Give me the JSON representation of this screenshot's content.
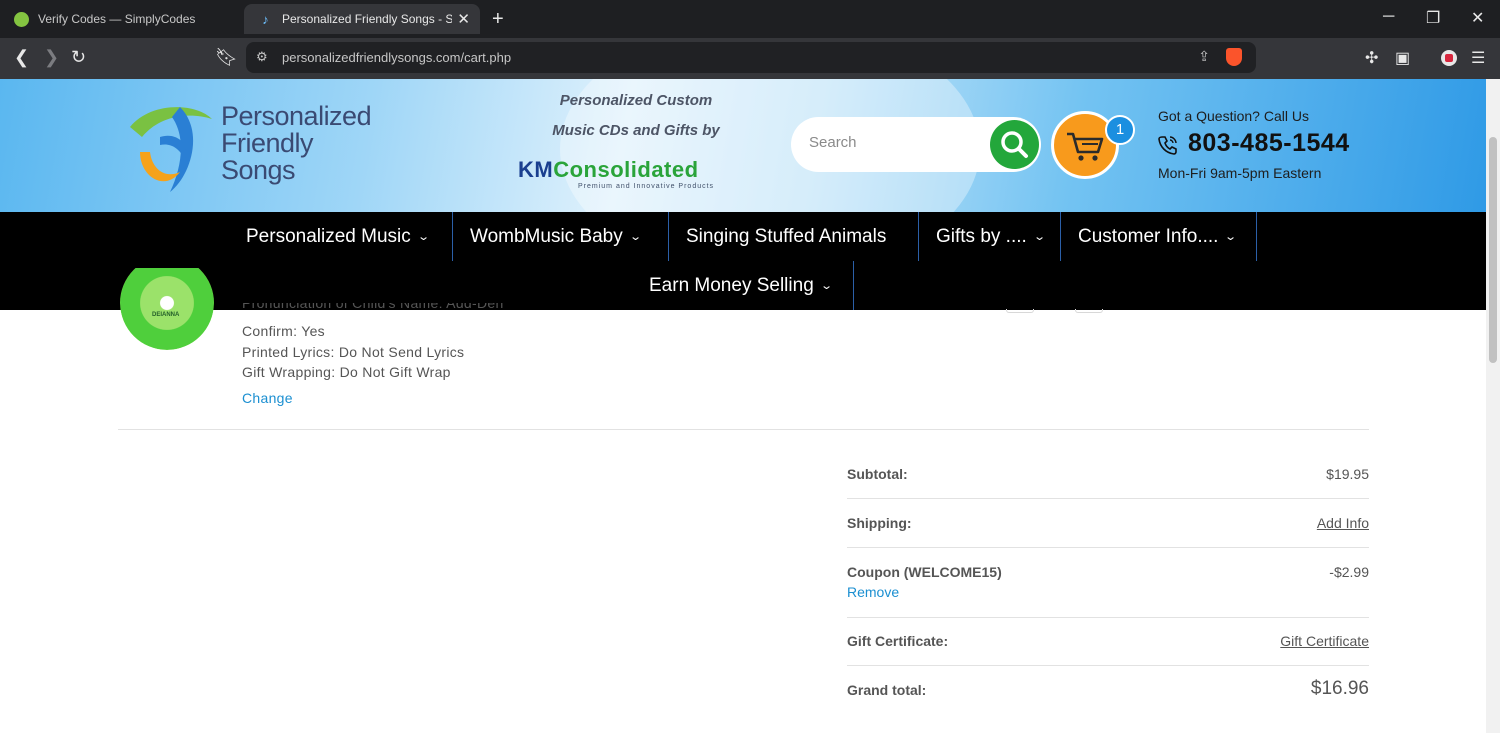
{
  "browser": {
    "tabs": [
      {
        "title": "Verify Codes — SimplyCodes",
        "active": false
      },
      {
        "title": "Personalized Friendly Songs - Sh",
        "active": true
      }
    ],
    "url": "personalizedfriendlysongs.com/cart.php"
  },
  "header": {
    "logo_line1": "Personalized",
    "logo_line2": "Friendly",
    "logo_line3": "Songs",
    "tagline_line1": "Personalized Custom",
    "tagline_line2": "Music CDs and Gifts by",
    "km_logo_km": "KM",
    "km_logo_rest": "Consolidated",
    "km_logo_sub": "Premium and Innovative Products",
    "search_placeholder": "Search",
    "cart_count": "1",
    "question": "Got a Question? Call Us",
    "phone": "803-485-1544",
    "hours": "Mon-Fri 9am-5pm Eastern"
  },
  "nav": {
    "items": [
      {
        "label": "Personalized Music",
        "has_dropdown": true
      },
      {
        "label": "WombMusic Baby",
        "has_dropdown": true
      },
      {
        "label": "Singing Stuffed Animals",
        "has_dropdown": false
      },
      {
        "label": "Gifts by ....",
        "has_dropdown": true
      },
      {
        "label": "Customer Info....",
        "has_dropdown": true
      },
      {
        "label": "Earn Money Selling",
        "has_dropdown": true
      }
    ]
  },
  "cart_item": {
    "cd_label": "DEIANNA",
    "details": [
      "Pronunciation of Child's Name: Add-Den",
      "Confirm: Yes",
      "Printed Lyrics: Do Not Send Lyrics",
      "Gift Wrapping: Do Not Gift Wrap"
    ],
    "change_label": "Change"
  },
  "totals": {
    "subtotal_label": "Subtotal:",
    "subtotal_value": "$19.95",
    "shipping_label": "Shipping:",
    "shipping_value": "Add Info",
    "coupon_label": "Coupon (WELCOME15)",
    "coupon_value": "-$2.99",
    "coupon_remove": "Remove",
    "gift_label": "Gift Certificate:",
    "gift_value": "Gift Certificate",
    "grand_label": "Grand total:",
    "grand_value": "$16.96"
  },
  "colors": {
    "accent_blue": "#1b8fd1",
    "search_green": "#23a73b",
    "cart_orange": "#f89a1c",
    "nav_bg": "#000000"
  }
}
